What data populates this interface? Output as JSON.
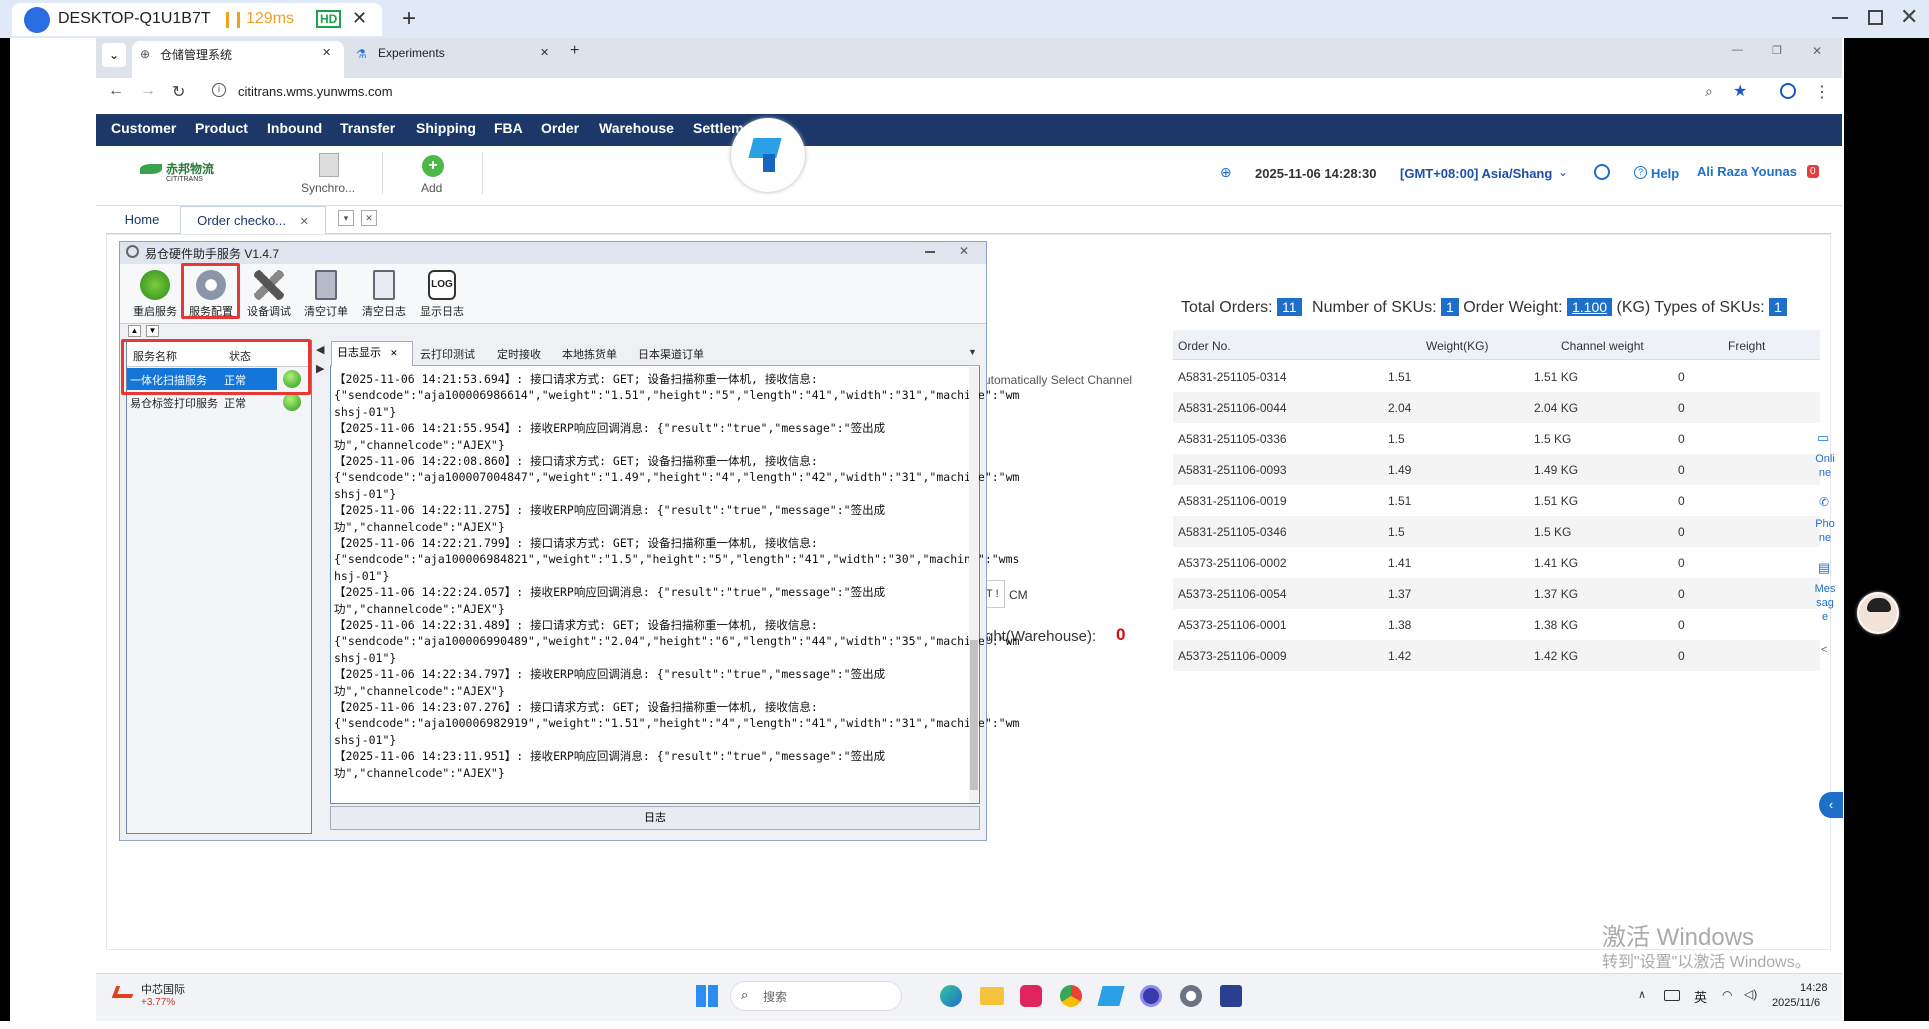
{
  "remote": {
    "host": "DESKTOP-Q1U1B7T",
    "latency": "129ms",
    "quality": "HD",
    "close": "✕",
    "new_tab": "+"
  },
  "browser": {
    "tabs": [
      {
        "title": "仓储管理系统",
        "close": "✕"
      },
      {
        "title": "Experiments",
        "close": "✕"
      }
    ],
    "new_tab": "+",
    "url": "cititrans.wms.yunwms.com",
    "controls": {
      "minimize": "—",
      "restore": "❐",
      "close": "✕"
    }
  },
  "menu": [
    "Customer",
    "Product",
    "Inbound",
    "Transfer",
    "Shipping",
    "FBA",
    "Order",
    "Warehouse",
    "Settlem"
  ],
  "toolbar": {
    "logo_text": "CITITRANS",
    "logo_cn": "赤邦物流",
    "sync_label": "Synchro...",
    "add_label": "Add",
    "datetime": "2025-11-06 14:28:30",
    "timezone": "[GMT+08:00] Asia/Shang",
    "help": "Help",
    "user": "Ali Raza Younas",
    "notif": "0"
  },
  "page_tabs": [
    {
      "label": "Home"
    },
    {
      "label": "Order checko...",
      "close": "✕"
    }
  ],
  "dialog": {
    "title": "易仓硬件助手服务 V1.4.7",
    "buttons": [
      "重启服务",
      "服务配置",
      "设备调试",
      "清空订单",
      "清空日志",
      "显示日志"
    ],
    "log_icon_text": "LOG",
    "services_header": {
      "name": "服务名称",
      "status": "状态"
    },
    "services": [
      {
        "name": "一体化扫描服务",
        "status": "正常"
      },
      {
        "name": "易仓标签打印服务",
        "status": "正常"
      }
    ],
    "tabs": [
      "日志显示",
      "云打印测试",
      "定时接收",
      "本地拣货单",
      "日本渠道订单"
    ],
    "tab_close": "✕",
    "footer": "日志",
    "log": [
      "【2025-11-06 14:21:53.694】: 接口请求方式: GET; 设备扫描称重一体机, 接收信息:",
      "{\"sendcode\":\"aja100006986614\",\"weight\":\"1.51\",\"height\":\"5\",\"length\":\"41\",\"width\":\"31\",\"machine\":\"wm",
      "shsj-01\"}",
      "【2025-11-06 14:21:55.954】: 接收ERP响应回调消息: {\"result\":\"true\",\"message\":\"签出成",
      "功\",\"channelcode\":\"AJEX\"}",
      "【2025-11-06 14:22:08.860】: 接口请求方式: GET; 设备扫描称重一体机, 接收信息:",
      "{\"sendcode\":\"aja100007004847\",\"weight\":\"1.49\",\"height\":\"4\",\"length\":\"42\",\"width\":\"31\",\"machine\":\"wm",
      "shsj-01\"}",
      "【2025-11-06 14:22:11.275】: 接收ERP响应回调消息: {\"result\":\"true\",\"message\":\"签出成",
      "功\",\"channelcode\":\"AJEX\"}",
      "【2025-11-06 14:22:21.799】: 接口请求方式: GET; 设备扫描称重一体机, 接收信息:",
      "{\"sendcode\":\"aja100006984821\",\"weight\":\"1.5\",\"height\":\"5\",\"length\":\"41\",\"width\":\"30\",\"machine\":\"wms",
      "hsj-01\"}",
      "【2025-11-06 14:22:24.057】: 接收ERP响应回调消息: {\"result\":\"true\",\"message\":\"签出成",
      "功\",\"channelcode\":\"AJEX\"}",
      "【2025-11-06 14:22:31.489】: 接口请求方式: GET; 设备扫描称重一体机, 接收信息:",
      "{\"sendcode\":\"aja100006990489\",\"weight\":\"2.04\",\"height\":\"6\",\"length\":\"44\",\"width\":\"35\",\"machine\":\"wm",
      "shsj-01\"}",
      "【2025-11-06 14:22:34.797】: 接收ERP响应回调消息: {\"result\":\"true\",\"message\":\"签出成",
      "功\",\"channelcode\":\"AJEX\"}",
      "【2025-11-06 14:23:07.276】: 接口请求方式: GET; 设备扫描称重一体机, 接收信息:",
      "{\"sendcode\":\"aja100006982919\",\"weight\":\"1.51\",\"height\":\"4\",\"length\":\"41\",\"width\":\"31\",\"machine\":\"wm",
      "shsj-01\"}",
      "【2025-11-06 14:23:11.951】: 接收ERP响应回调消息: {\"result\":\"true\",\"message\":\"签出成",
      "功\",\"channelcode\":\"AJEX\"}"
    ]
  },
  "partial": {
    "auto_channel": "utomatically Select Channel",
    "cm": "CM",
    "cm_prefix": "T !",
    "weight_label": "ght(Warehouse):",
    "weight_value": "0"
  },
  "summary": {
    "total_orders_label": "Total Orders:",
    "total_orders": "11",
    "skus_label": "Number of SKUs:",
    "skus": "1",
    "weight_label": "Order Weight:",
    "weight": "1.100",
    "weight_unit": "(KG)",
    "types_label": "Types of SKUs:",
    "types": "1"
  },
  "orders_table": {
    "headers": [
      "Order No.",
      "Weight(KG)",
      "Channel weight",
      "Freight"
    ],
    "rows": [
      [
        "A5831-251105-0314",
        "1.51",
        "1.51 KG",
        "0"
      ],
      [
        "A5831-251106-0044",
        "2.04",
        "2.04 KG",
        "0"
      ],
      [
        "A5831-251105-0336",
        "1.5",
        "1.5 KG",
        "0"
      ],
      [
        "A5831-251106-0093",
        "1.49",
        "1.49 KG",
        "0"
      ],
      [
        "A5831-251106-0019",
        "1.51",
        "1.51 KG",
        "0"
      ],
      [
        "A5831-251105-0346",
        "1.5",
        "1.5 KG",
        "0"
      ],
      [
        "A5373-251106-0002",
        "1.41",
        "1.41 KG",
        "0"
      ],
      [
        "A5373-251106-0054",
        "1.37",
        "1.37 KG",
        "0"
      ],
      [
        "A5373-251106-0001",
        "1.38",
        "1.38 KG",
        "0"
      ],
      [
        "A5373-251106-0009",
        "1.42",
        "1.42 KG",
        "0"
      ]
    ]
  },
  "side": {
    "online": "Onli ne",
    "phone": "Pho ne",
    "message": "Mes sag e"
  },
  "watermark": {
    "line1": "激活 Windows",
    "line2": "转到\"设置\"以激活 Windows。"
  },
  "taskbar": {
    "stock_name": "中芯国际",
    "stock_change": "+3.77%",
    "search": "搜索",
    "ime": "英",
    "time": "14:28",
    "date": "2025/11/6"
  }
}
